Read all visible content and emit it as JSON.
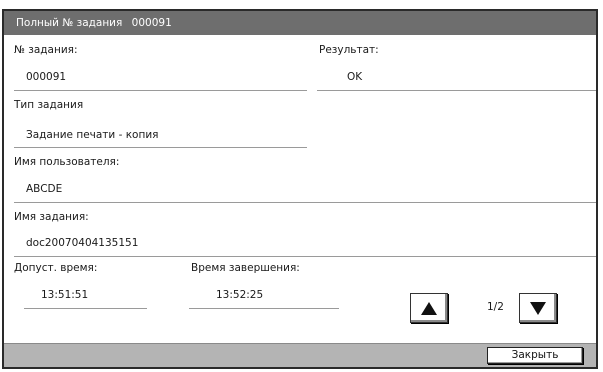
{
  "header": {
    "title": "Полный № задания",
    "job_number": "000091"
  },
  "fields": {
    "job_no_label": "№ задания:",
    "job_no_value": "000091",
    "result_label": "Результат:",
    "result_value": "OK",
    "job_type_label": "Тип задания",
    "job_type_value": "Задание печати - копия",
    "user_name_label": "Имя пользователя:",
    "user_name_value": "ABCDE",
    "job_name_label": "Имя задания:",
    "job_name_value": "doc20070404135151",
    "accept_time_label": "Допуст. время:",
    "accept_time_value": "13:51:51",
    "end_time_label": "Время завершения:",
    "end_time_value": "13:52:25"
  },
  "pager": {
    "page_indicator": "1/2",
    "up_icon": "up-arrow-icon",
    "down_icon": "down-arrow-icon"
  },
  "footer": {
    "close_label": "Закрыть"
  }
}
